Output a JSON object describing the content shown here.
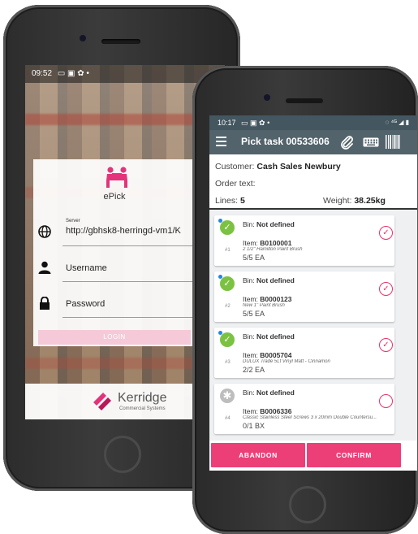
{
  "back_phone": {
    "status_time": "09:52",
    "status_icons": "▭ ▣ ✿ •",
    "app_name": "ePick",
    "server_label": "Server",
    "server_value": "http://gbhsk8-herringd-vm1/K",
    "username_placeholder": "Username",
    "password_placeholder": "Password",
    "login_label": "LOGIN",
    "brand_name": "Kerridge",
    "brand_sub": "Commercial Systems"
  },
  "front_phone": {
    "status_time": "10:17",
    "status_icons": "▭ ▣ ✿ •",
    "status_right": "◌ ⁴ᴳ ◢ ▮",
    "title": "Pick task 00533606",
    "customer_label": "Customer:",
    "customer_value": "Cash Sales Newbury",
    "order_text_label": "Order text:",
    "lines_label": "Lines:",
    "lines_value": "5",
    "weight_label": "Weight:",
    "weight_value": "38.25kg",
    "items": [
      {
        "status": "done",
        "status_symbol": "✓",
        "bin_label": "Bin:",
        "bin_value": "Not defined",
        "item_label": "Item:",
        "item_code": "B0100001",
        "num": "#1",
        "description": "2 1/2\" Hamilton Paint Brush",
        "qty": "5/5 EA",
        "checked": true
      },
      {
        "status": "done",
        "status_symbol": "✓",
        "bin_label": "Bin:",
        "bin_value": "Not defined",
        "item_label": "Item:",
        "item_code": "B0000123",
        "num": "#2",
        "description": "New 1\" Paint Brush",
        "qty": "5/5 EA",
        "checked": true
      },
      {
        "status": "done",
        "status_symbol": "✓",
        "bin_label": "Bin:",
        "bin_value": "Not defined",
        "item_label": "Item:",
        "item_code": "B0005704",
        "num": "#3",
        "description": "DULUX Trade 5Lt Vinyl Matt - Cinnamon",
        "qty": "2/2 EA",
        "checked": true
      },
      {
        "status": "todo",
        "status_symbol": "✱",
        "bin_label": "Bin:",
        "bin_value": "Not defined",
        "item_label": "Item:",
        "item_code": "B0006336",
        "num": "#4",
        "description": "Classic Stainless Steel Screws 3 x 20mm Double Countersu...",
        "qty": "0/1 BX",
        "checked": false
      }
    ],
    "abandon_label": "ABANDON",
    "confirm_label": "CONFIRM"
  },
  "colors": {
    "accent": "#ec3f78",
    "appbar": "#52636b",
    "done_green": "#7cc242"
  }
}
